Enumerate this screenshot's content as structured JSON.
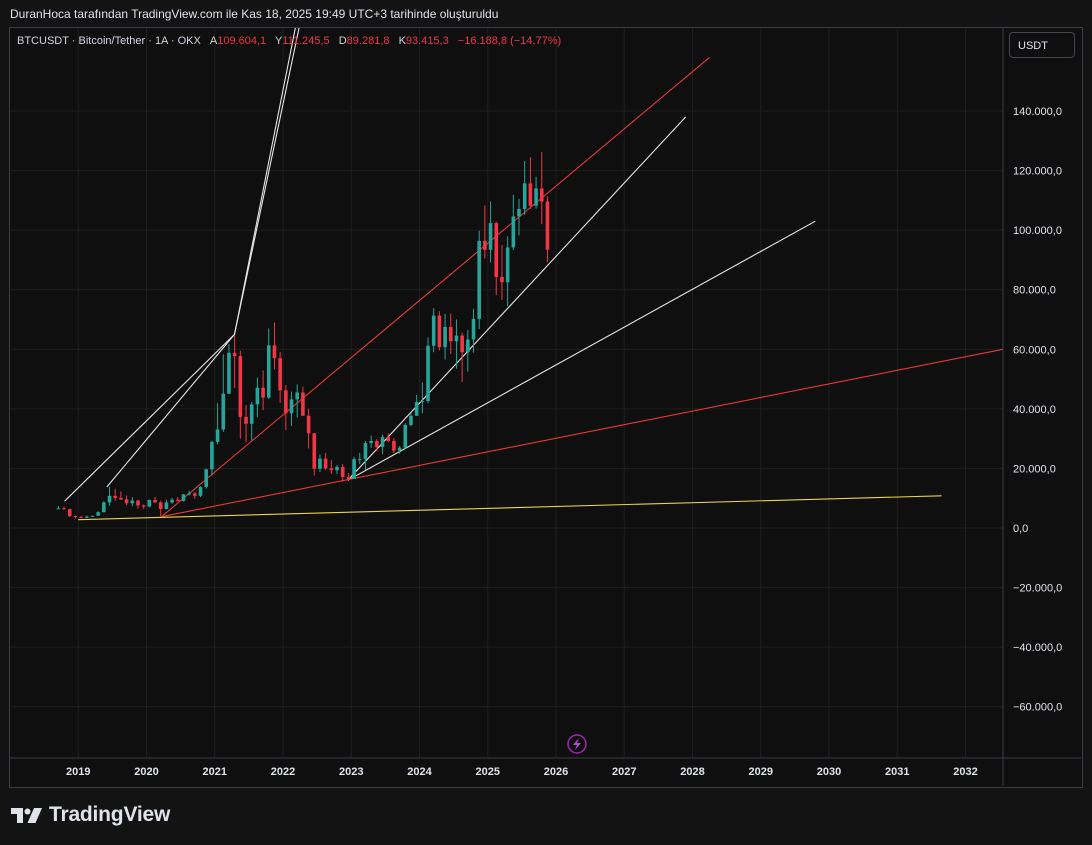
{
  "caption": "DuranHoca tarafından TradingView.com ile Kas 18, 2025 19:49 UTC+3 tarihinde oluşturuldu",
  "legend": {
    "symbol": "BTCUSDT · Bitcoin/Tether · 1A · OKX",
    "open_label": "A",
    "open": "109.604,1",
    "high_label": "Y",
    "high": "111.245,5",
    "low_label": "D",
    "low": "89.281,8",
    "close_label": "K",
    "close": "93.415,3",
    "change": "−16.188,8 (−14,77%)"
  },
  "currency_button": "USDT",
  "brand": "TradingView",
  "colors": {
    "up": "#26a69a",
    "down": "#f23645",
    "white_line": "#e6e6e6",
    "red_line": "#e53935",
    "yellow_line": "#e8d44d",
    "grid": "#1f1f1f"
  },
  "chart_data": {
    "type": "candlestick",
    "timeframe": "1 month",
    "y_ticks": [
      140000,
      120000,
      100000,
      80000,
      60000,
      40000,
      20000,
      0,
      -20000,
      -40000,
      -60000
    ],
    "y_tick_labels": [
      "140.000,0",
      "120.000,0",
      "100.000,0",
      "80.000,0",
      "60.000,0",
      "40.000,0",
      "20.000,0",
      "0,0",
      "−20.000,0",
      "−40.000,0",
      "−60.000,0"
    ],
    "x_ticks": [
      "2019",
      "2020",
      "2021",
      "2022",
      "2023",
      "2024",
      "2025",
      "2026",
      "2027",
      "2028",
      "2029",
      "2030",
      "2031",
      "2032"
    ],
    "ylim": [
      -68000,
      158000
    ],
    "xlim": [
      2018.0,
      2032.55
    ],
    "grid": true,
    "candles": [
      {
        "t": "2018-09",
        "o": 6600,
        "h": 7400,
        "l": 6400,
        "c": 6600
      },
      {
        "t": "2018-10",
        "o": 6600,
        "h": 7200,
        "l": 6200,
        "c": 6300
      },
      {
        "t": "2018-11",
        "o": 6300,
        "h": 6500,
        "l": 3700,
        "c": 4000
      },
      {
        "t": "2018-12",
        "o": 4000,
        "h": 4200,
        "l": 3200,
        "c": 3700
      },
      {
        "t": "2019-01",
        "o": 3700,
        "h": 4100,
        "l": 3400,
        "c": 3400
      },
      {
        "t": "2019-02",
        "o": 3400,
        "h": 4200,
        "l": 3400,
        "c": 3800
      },
      {
        "t": "2019-03",
        "o": 3800,
        "h": 4100,
        "l": 3700,
        "c": 4100
      },
      {
        "t": "2019-04",
        "o": 4100,
        "h": 5600,
        "l": 4100,
        "c": 5300
      },
      {
        "t": "2019-05",
        "o": 5300,
        "h": 9000,
        "l": 5300,
        "c": 8600
      },
      {
        "t": "2019-06",
        "o": 8600,
        "h": 13800,
        "l": 7500,
        "c": 10800
      },
      {
        "t": "2019-07",
        "o": 10800,
        "h": 13200,
        "l": 9100,
        "c": 10100
      },
      {
        "t": "2019-08",
        "o": 10100,
        "h": 12300,
        "l": 9400,
        "c": 9600
      },
      {
        "t": "2019-09",
        "o": 9600,
        "h": 10900,
        "l": 7700,
        "c": 8300
      },
      {
        "t": "2019-10",
        "o": 8300,
        "h": 10400,
        "l": 7300,
        "c": 9200
      },
      {
        "t": "2019-11",
        "o": 9200,
        "h": 9500,
        "l": 6500,
        "c": 7600
      },
      {
        "t": "2019-12",
        "o": 7600,
        "h": 7900,
        "l": 6400,
        "c": 7200
      },
      {
        "t": "2020-01",
        "o": 7200,
        "h": 9600,
        "l": 6900,
        "c": 9400
      },
      {
        "t": "2020-02",
        "o": 9400,
        "h": 10500,
        "l": 8400,
        "c": 8600
      },
      {
        "t": "2020-03",
        "o": 8600,
        "h": 9200,
        "l": 3800,
        "c": 6400
      },
      {
        "t": "2020-04",
        "o": 6400,
        "h": 9500,
        "l": 6200,
        "c": 8600
      },
      {
        "t": "2020-05",
        "o": 8600,
        "h": 10100,
        "l": 8100,
        "c": 9500
      },
      {
        "t": "2020-06",
        "o": 9500,
        "h": 10400,
        "l": 8900,
        "c": 9100
      },
      {
        "t": "2020-07",
        "o": 9100,
        "h": 11400,
        "l": 8900,
        "c": 11300
      },
      {
        "t": "2020-08",
        "o": 11300,
        "h": 12500,
        "l": 10900,
        "c": 11600
      },
      {
        "t": "2020-09",
        "o": 11600,
        "h": 12100,
        "l": 9800,
        "c": 10800
      },
      {
        "t": "2020-10",
        "o": 10800,
        "h": 14000,
        "l": 10400,
        "c": 13800
      },
      {
        "t": "2020-11",
        "o": 13800,
        "h": 19900,
        "l": 13200,
        "c": 19700
      },
      {
        "t": "2020-12",
        "o": 19700,
        "h": 29300,
        "l": 17600,
        "c": 28900
      },
      {
        "t": "2021-01",
        "o": 28900,
        "h": 41900,
        "l": 28100,
        "c": 33100
      },
      {
        "t": "2021-02",
        "o": 33100,
        "h": 58300,
        "l": 32300,
        "c": 45100
      },
      {
        "t": "2021-03",
        "o": 45100,
        "h": 61700,
        "l": 44900,
        "c": 58800
      },
      {
        "t": "2021-04",
        "o": 58800,
        "h": 64800,
        "l": 47000,
        "c": 57700
      },
      {
        "t": "2021-05",
        "o": 57700,
        "h": 59500,
        "l": 30000,
        "c": 37300
      },
      {
        "t": "2021-06",
        "o": 37300,
        "h": 41300,
        "l": 28800,
        "c": 35000
      },
      {
        "t": "2021-07",
        "o": 35000,
        "h": 42300,
        "l": 29300,
        "c": 41500
      },
      {
        "t": "2021-08",
        "o": 41500,
        "h": 50500,
        "l": 37300,
        "c": 47100
      },
      {
        "t": "2021-09",
        "o": 47100,
        "h": 52900,
        "l": 39600,
        "c": 43800
      },
      {
        "t": "2021-10",
        "o": 43800,
        "h": 67000,
        "l": 43300,
        "c": 61300
      },
      {
        "t": "2021-11",
        "o": 61300,
        "h": 69000,
        "l": 53300,
        "c": 57000
      },
      {
        "t": "2021-12",
        "o": 57000,
        "h": 59100,
        "l": 42000,
        "c": 46200
      },
      {
        "t": "2022-01",
        "o": 46200,
        "h": 48000,
        "l": 32900,
        "c": 38500
      },
      {
        "t": "2022-02",
        "o": 38500,
        "h": 45800,
        "l": 34300,
        "c": 43200
      },
      {
        "t": "2022-03",
        "o": 43200,
        "h": 48200,
        "l": 37100,
        "c": 45500
      },
      {
        "t": "2022-04",
        "o": 45500,
        "h": 47400,
        "l": 37600,
        "c": 37700
      },
      {
        "t": "2022-05",
        "o": 37700,
        "h": 40000,
        "l": 26700,
        "c": 31800
      },
      {
        "t": "2022-06",
        "o": 31800,
        "h": 31900,
        "l": 17600,
        "c": 19900
      },
      {
        "t": "2022-07",
        "o": 19900,
        "h": 24700,
        "l": 18800,
        "c": 23300
      },
      {
        "t": "2022-08",
        "o": 23300,
        "h": 25200,
        "l": 19500,
        "c": 20000
      },
      {
        "t": "2022-09",
        "o": 20000,
        "h": 22800,
        "l": 18200,
        "c": 19400
      },
      {
        "t": "2022-10",
        "o": 19400,
        "h": 21100,
        "l": 18200,
        "c": 20500
      },
      {
        "t": "2022-11",
        "o": 20500,
        "h": 21500,
        "l": 15500,
        "c": 17100
      },
      {
        "t": "2022-12",
        "o": 17100,
        "h": 18400,
        "l": 16300,
        "c": 16500
      },
      {
        "t": "2023-01",
        "o": 16500,
        "h": 23900,
        "l": 16500,
        "c": 23100
      },
      {
        "t": "2023-02",
        "o": 23100,
        "h": 25200,
        "l": 21400,
        "c": 23100
      },
      {
        "t": "2023-03",
        "o": 23100,
        "h": 29200,
        "l": 19500,
        "c": 28500
      },
      {
        "t": "2023-04",
        "o": 28500,
        "h": 31000,
        "l": 26900,
        "c": 29200
      },
      {
        "t": "2023-05",
        "o": 29200,
        "h": 29800,
        "l": 25800,
        "c": 27200
      },
      {
        "t": "2023-06",
        "o": 27200,
        "h": 31400,
        "l": 24800,
        "c": 30500
      },
      {
        "t": "2023-07",
        "o": 30500,
        "h": 31800,
        "l": 28900,
        "c": 29200
      },
      {
        "t": "2023-08",
        "o": 29200,
        "h": 30200,
        "l": 25200,
        "c": 26000
      },
      {
        "t": "2023-09",
        "o": 26000,
        "h": 27500,
        "l": 24900,
        "c": 27000
      },
      {
        "t": "2023-10",
        "o": 27000,
        "h": 35200,
        "l": 26600,
        "c": 34600
      },
      {
        "t": "2023-11",
        "o": 34600,
        "h": 38400,
        "l": 34100,
        "c": 37700
      },
      {
        "t": "2023-12",
        "o": 37700,
        "h": 44700,
        "l": 37600,
        "c": 42300
      },
      {
        "t": "2024-01",
        "o": 42300,
        "h": 48900,
        "l": 38500,
        "c": 42600
      },
      {
        "t": "2024-02",
        "o": 42600,
        "h": 64000,
        "l": 41900,
        "c": 61200
      },
      {
        "t": "2024-03",
        "o": 61200,
        "h": 73800,
        "l": 59000,
        "c": 71300
      },
      {
        "t": "2024-04",
        "o": 71300,
        "h": 72800,
        "l": 59600,
        "c": 60700
      },
      {
        "t": "2024-05",
        "o": 60700,
        "h": 71900,
        "l": 56600,
        "c": 67500
      },
      {
        "t": "2024-06",
        "o": 67500,
        "h": 72000,
        "l": 58400,
        "c": 62700
      },
      {
        "t": "2024-07",
        "o": 62700,
        "h": 70000,
        "l": 53500,
        "c": 64600
      },
      {
        "t": "2024-08",
        "o": 64600,
        "h": 65600,
        "l": 49000,
        "c": 59000
      },
      {
        "t": "2024-09",
        "o": 59000,
        "h": 66500,
        "l": 52500,
        "c": 63300
      },
      {
        "t": "2024-10",
        "o": 63300,
        "h": 73600,
        "l": 58900,
        "c": 70200
      },
      {
        "t": "2024-11",
        "o": 70200,
        "h": 99800,
        "l": 66800,
        "c": 96400
      },
      {
        "t": "2024-12",
        "o": 96400,
        "h": 108300,
        "l": 90500,
        "c": 93400
      },
      {
        "t": "2025-01",
        "o": 93400,
        "h": 109600,
        "l": 89200,
        "c": 102400
      },
      {
        "t": "2025-02",
        "o": 102400,
        "h": 102800,
        "l": 78200,
        "c": 84300
      },
      {
        "t": "2025-03",
        "o": 84300,
        "h": 95000,
        "l": 76600,
        "c": 82500
      },
      {
        "t": "2025-04",
        "o": 82500,
        "h": 97900,
        "l": 74500,
        "c": 94200
      },
      {
        "t": "2025-05",
        "o": 94200,
        "h": 111900,
        "l": 93300,
        "c": 104600
      },
      {
        "t": "2025-06",
        "o": 104600,
        "h": 110500,
        "l": 98200,
        "c": 107100
      },
      {
        "t": "2025-07",
        "o": 107100,
        "h": 123200,
        "l": 105100,
        "c": 115700
      },
      {
        "t": "2025-08",
        "o": 115700,
        "h": 124500,
        "l": 107200,
        "c": 108200
      },
      {
        "t": "2025-09",
        "o": 108200,
        "h": 117900,
        "l": 107200,
        "c": 114000
      },
      {
        "t": "2025-10",
        "o": 114000,
        "h": 126200,
        "l": 102000,
        "c": 109600
      },
      {
        "t": "2025-11",
        "o": 109604.1,
        "h": 111245.5,
        "l": 89281.8,
        "c": 93415.3
      }
    ],
    "trendlines": [
      {
        "color": "white",
        "points": [
          [
            2018.8,
            9000
          ],
          [
            2021.29,
            65000
          ],
          [
            2022.2,
            170000
          ]
        ]
      },
      {
        "color": "white",
        "points": [
          [
            2019.42,
            13800
          ],
          [
            2021.29,
            65000
          ],
          [
            2022.3,
            175000
          ]
        ]
      },
      {
        "color": "white",
        "points": [
          [
            2022.95,
            16000
          ],
          [
            2027.9,
            138000
          ]
        ]
      },
      {
        "color": "white",
        "points": [
          [
            2022.95,
            16000
          ],
          [
            2029.8,
            103000
          ]
        ]
      },
      {
        "color": "red",
        "points": [
          [
            2020.22,
            3800
          ],
          [
            2028.25,
            158000
          ]
        ]
      },
      {
        "color": "red",
        "points": [
          [
            2020.22,
            3800
          ],
          [
            2032.55,
            60000
          ]
        ]
      },
      {
        "color": "yellow",
        "points": [
          [
            2019.0,
            2800
          ],
          [
            2031.65,
            10800
          ]
        ]
      }
    ]
  }
}
